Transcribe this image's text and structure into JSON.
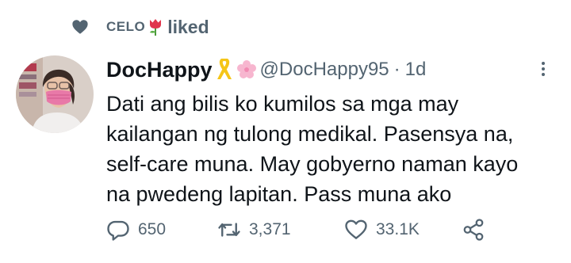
{
  "social_context": {
    "username": "CELO",
    "action": "liked"
  },
  "tweet": {
    "display_name": "DocHappy",
    "handle": "@DocHappy95",
    "separator": "·",
    "time": "1d",
    "lines": [
      "Dati ang bilis ko kumilos sa mga may",
      "kailangan ng tulong medikal. Pasensya na,",
      "self-care muna. May gobyerno naman kayo",
      "na pwedeng lapitan. Pass muna ako"
    ]
  },
  "actions": {
    "replies": "650",
    "retweets": "3,371",
    "likes": "33.1K"
  },
  "icons": {
    "liked": "heart-filled-icon",
    "tulip": "tulip-emoji",
    "ribbon": "yellow-ribbon-emoji",
    "blossom": "cherry-blossom-emoji",
    "more": "more-vertical-icon",
    "reply": "reply-icon",
    "retweet": "retweet-icon",
    "like": "heart-outline-icon",
    "share": "share-icon"
  },
  "colors": {
    "text_primary": "#0f1419",
    "text_secondary": "#536471"
  }
}
